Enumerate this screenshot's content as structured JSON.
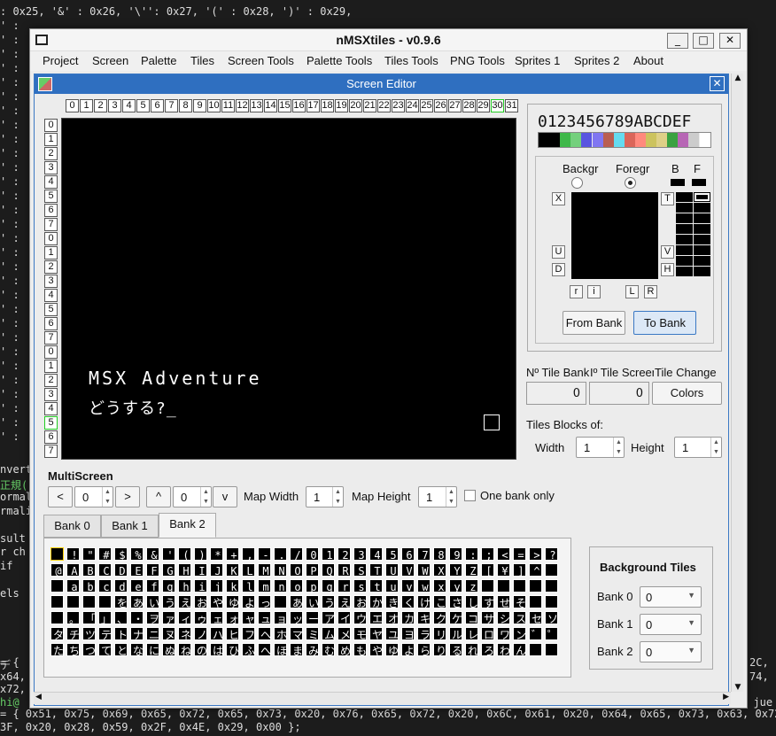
{
  "terminal": {
    "top_line": ": 0x25, '&' : 0x26, '\\'': 0x27, '(' : 0x28, ')' : 0x29,",
    "left_chars": [
      "' :",
      "' :",
      "' :",
      "' :",
      "' :",
      "' :",
      "' :",
      "' :",
      "' :",
      "' :",
      "' :",
      "' :",
      "' :",
      "' :",
      "' :",
      "' :",
      "' :",
      "' :",
      "' :",
      "' :",
      "' :",
      "' :",
      "' :",
      "' :",
      "' :",
      "' :",
      "' :",
      "' :",
      "' :",
      "' :"
    ],
    "left_words": [
      "nvert",
      "正規(",
      "ormal",
      "rmali",
      "",
      "sult",
      "r ch",
      "if",
      "",
      "els"
    ],
    "left_mark": "デ",
    "right_fragments": [
      "2C,",
      "74,",
      "l jue"
    ],
    "bottom_left": [
      "= {",
      "x64,",
      "x72,",
      "hi@"
    ],
    "bottom_line1": "= { 0x51, 0x75, 0x69, 0x65, 0x72, 0x65, 0x73, 0x20, 0x76, 0x65, 0x72, 0x20, 0x6C, 0x61, 0x20, 0x64, 0x65, 0x73, 0x63, 0x72,",
    "bottom_line2": "3F, 0x20, 0x28, 0x59, 0x2F, 0x4E, 0x29, 0x00 };"
  },
  "app": {
    "title": "nMSXtiles - v0.9.6",
    "window_buttons": [
      "_",
      "□",
      "✕"
    ],
    "menu": [
      "Project",
      "Screen",
      "Palette",
      "Tiles",
      "Screen Tools",
      "Palette Tools",
      "Tiles Tools",
      "PNG Tools",
      "Sprites 1",
      "Sprites 2",
      "About"
    ]
  },
  "editor": {
    "title": "Screen Editor",
    "close": "✕",
    "col_headers": [
      "0",
      "1",
      "2",
      "3",
      "4",
      "5",
      "6",
      "7",
      "8",
      "9",
      "10",
      "11",
      "12",
      "13",
      "14",
      "15",
      "16",
      "17",
      "18",
      "19",
      "20",
      "21",
      "22",
      "23",
      "24",
      "25",
      "26",
      "27",
      "28",
      "29",
      "30",
      "31"
    ],
    "row_headers": [
      "0",
      "1",
      "2",
      "3",
      "4",
      "5",
      "6",
      "7",
      "0",
      "1",
      "2",
      "3",
      "4",
      "5",
      "6",
      "7",
      "0",
      "1",
      "2",
      "3",
      "4",
      "5",
      "6",
      "7"
    ],
    "screen_text1": "MSX Adventure",
    "screen_text2": "どうする?_"
  },
  "palette": {
    "hex_label": "0123456789ABCDEF",
    "colors": [
      "#000000",
      "#000000",
      "#3eb849",
      "#74d07d",
      "#5955e0",
      "#8076f1",
      "#b95e51",
      "#65dbef",
      "#db6559",
      "#ff897d",
      "#ccc35e",
      "#ded087",
      "#3aa241",
      "#b766b5",
      "#cccccc",
      "#ffffff"
    ],
    "backgr": "Backgr",
    "foregr": "Foregr",
    "b": "B",
    "f": "F",
    "side_left": [
      "X",
      "U",
      "D"
    ],
    "side_right": [
      "T",
      "V",
      "H"
    ],
    "bottom_buttons": [
      "r",
      "i",
      "L",
      "R"
    ],
    "from_bank": "From Bank",
    "to_bank": "To Bank"
  },
  "info": {
    "tile_bank_label": "Nº Tile Bank",
    "tile_screen_label": "Iº Tile Screen",
    "tile_change_label": "Tile Change",
    "tile_bank_value": "0",
    "tile_screen_value": "0",
    "colors_button": "Colors",
    "blocks_label": "Tiles Blocks of:",
    "width_label": "Width",
    "width_value": "1",
    "height_label": "Height",
    "height_value": "1"
  },
  "multiscreen": {
    "label": "MultiScreen",
    "prev": "<",
    "h_value": "0",
    "next": ">",
    "up": "^",
    "v_value": "0",
    "down": "v",
    "map_width_label": "Map Width",
    "map_width_value": "1",
    "map_height_label": "Map Height",
    "map_height_value": "1",
    "one_bank_label": "One bank only"
  },
  "banks": {
    "tabs": [
      "Bank 0",
      "Bank 1",
      "Bank 2"
    ],
    "rows": [
      " !\"#$%&'()*+,-./0123456789:;<=>?",
      "@ABCDEFGHIJKLMNOPQRSTUVWXYZ[¥]^_",
      " abcdefghijklmnopqrstuvwxyz     ",
      "    をあいうえおやゆよっ あいうえおかきくけこさしすせそ",
      " 。「」、・ヲァィゥェォャュョッーアイウエオカキクケコサシスセソ",
      "タチツテトナニヌネノハヒフヘホマミムメモヤユヨラリルレロワン゛゜",
      "たちつてとなにぬねのはひふへほまみむめもやゆよらりるれろわん  "
    ]
  },
  "background_tiles": {
    "title": "Background Tiles",
    "items": [
      {
        "label": "Bank 0",
        "value": "0"
      },
      {
        "label": "Bank 1",
        "value": "0"
      },
      {
        "label": "Bank 2",
        "value": "0"
      }
    ]
  }
}
